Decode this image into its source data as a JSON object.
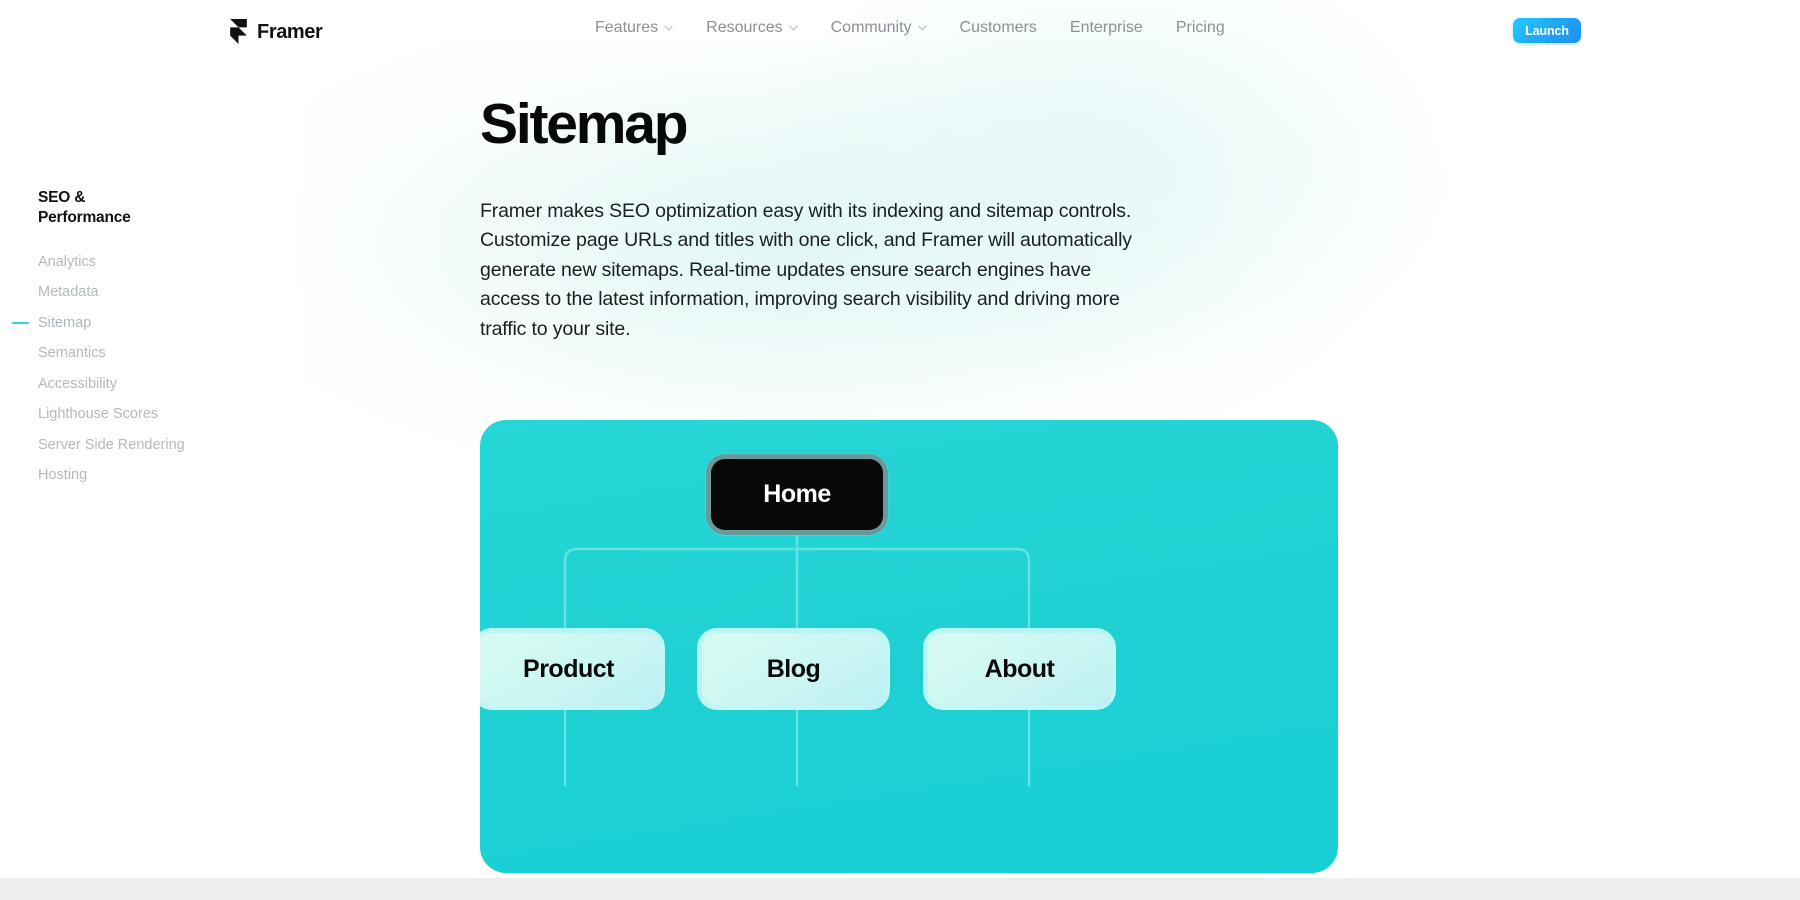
{
  "brand": {
    "name": "Framer",
    "logo_icon": "framer-logo-icon"
  },
  "nav": {
    "items": [
      {
        "label": "Features",
        "has_dropdown": true,
        "chevron_icon": "chevron-down-icon"
      },
      {
        "label": "Resources",
        "has_dropdown": true,
        "chevron_icon": "chevron-down-icon"
      },
      {
        "label": "Community",
        "has_dropdown": true,
        "chevron_icon": "chevron-down-icon"
      },
      {
        "label": "Customers",
        "has_dropdown": false,
        "chevron_icon": ""
      },
      {
        "label": "Enterprise",
        "has_dropdown": false,
        "chevron_icon": ""
      },
      {
        "label": "Pricing",
        "has_dropdown": false,
        "chevron_icon": ""
      }
    ],
    "cta_label": "Launch"
  },
  "sidebar": {
    "title": "SEO & Performance",
    "active_indicator_color": "#2AD9D4",
    "items": [
      {
        "label": "Analytics",
        "active": false
      },
      {
        "label": "Metadata",
        "active": false
      },
      {
        "label": "Sitemap",
        "active": true
      },
      {
        "label": "Semantics",
        "active": false
      },
      {
        "label": "Accessibility",
        "active": false
      },
      {
        "label": "Lighthouse Scores",
        "active": false
      },
      {
        "label": "Server Side Rendering",
        "active": false
      },
      {
        "label": "Hosting",
        "active": false
      }
    ]
  },
  "main": {
    "title": "Sitemap",
    "body": "Framer makes SEO optimization easy with its indexing and sitemap controls. Customize page URLs and titles with one click, and Framer will automatically generate new sitemaps. Real-time updates ensure search engines have access to the latest information, improving search visibility and driving more traffic to your site."
  },
  "sitemap_diagram": {
    "card_color": "#21D1D3",
    "root": {
      "label": "Home",
      "style": "dark"
    },
    "children": [
      {
        "label": "Product",
        "style": "light"
      },
      {
        "label": "Blog",
        "style": "light"
      },
      {
        "label": "About",
        "style": "light"
      }
    ],
    "connector_color": "#6BE6E4"
  },
  "colors": {
    "accent_cyan": "#21D1D3",
    "accent_mint": "#CEF7F3",
    "cta_gradient_from": "#22CCFB",
    "cta_gradient_to": "#1F8FF2",
    "nav_text": "#8D9194",
    "sidebar_text": "#B4B9BC",
    "title_text": "#080808"
  }
}
